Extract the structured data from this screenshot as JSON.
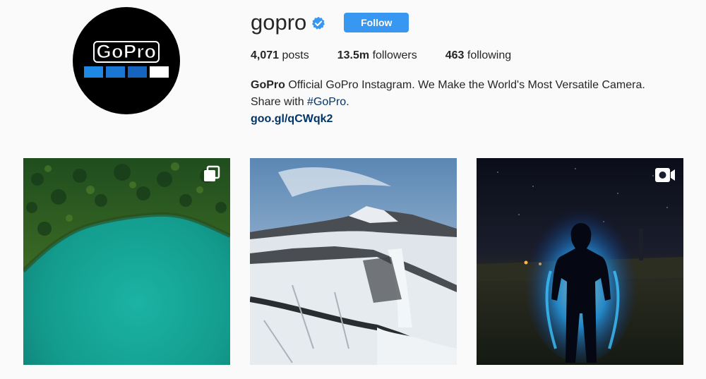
{
  "profile": {
    "username": "gopro",
    "follow_label": "Follow",
    "stats": {
      "posts_count": "4,071",
      "posts_label": "posts",
      "followers_count": "13.5m",
      "followers_label": "followers",
      "following_count": "463",
      "following_label": "following"
    },
    "bio": {
      "name": "GoPro",
      "text": "Official GoPro Instagram. We Make the World's Most Versatile Camera. Share with",
      "hashtag": "#GoPro",
      "after": ".",
      "link": "goo.gl/qCWqk2"
    },
    "avatar_logo_text": "GoPro"
  },
  "colors": {
    "follow_button": "#3897f0",
    "verified": "#3897f0",
    "link": "#003569",
    "background": "#fafafa"
  },
  "posts": [
    {
      "subject": "aerial forest lake",
      "badge": "multiple-images-icon"
    },
    {
      "subject": "snowy waterfall canyon",
      "badge": "none"
    },
    {
      "subject": "glowing blue figure at night",
      "badge": "video-icon"
    }
  ]
}
